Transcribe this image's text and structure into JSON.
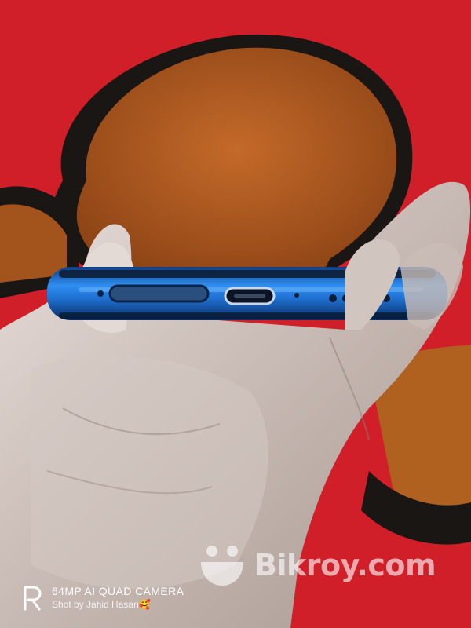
{
  "watermark": {
    "text": "Bikroy.com",
    "icon": "smiley-face-icon"
  },
  "camera": {
    "logo": "realme-r-logo",
    "title": "64MP AI QUAD CAMERA",
    "credit": "Shot by Jahid Hasan",
    "credit_emoji": "🥰"
  },
  "colors": {
    "rug_red": "#d8212b",
    "rug_brown": "#b45d22",
    "rug_black": "#1a1614",
    "phone_blue": "#1f6fd0",
    "skin": "#c9bdb7"
  }
}
